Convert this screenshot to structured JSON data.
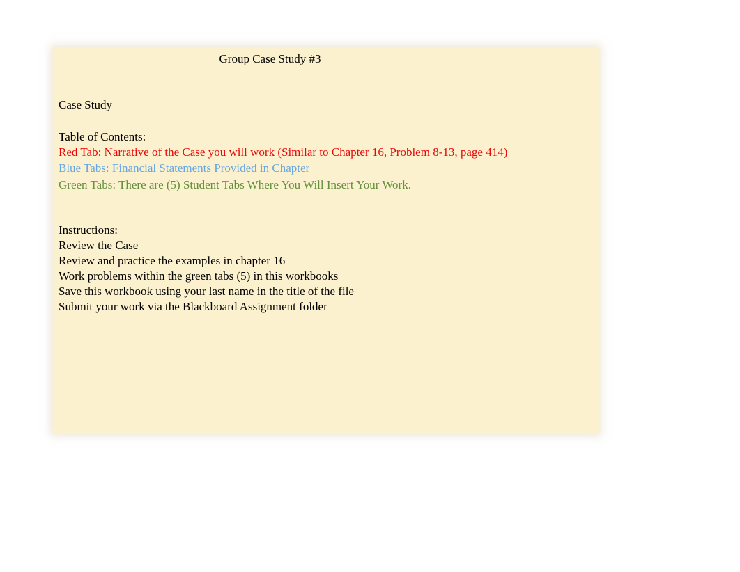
{
  "title": "Group Case Study #3",
  "case_study_heading": "Case Study",
  "toc": {
    "heading": "Table of Contents:",
    "red": "Red Tab: Narrative of the Case you will work (Similar to Chapter 16, Problem 8-13, page 414)",
    "blue": "Blue Tabs: Financial Statements Provided in Chapter",
    "green": "Green Tabs: There are (5) Student Tabs Where You Will Insert Your Work."
  },
  "instructions": {
    "heading": "Instructions:",
    "lines": [
      "Review the Case",
      "Review and practice the examples in chapter 16",
      "Work problems within the green tabs (5) in this workbooks",
      "Save this workbook using your last name in the title of the file",
      "Submit your work via the Blackboard Assignment folder"
    ]
  },
  "colors": {
    "background": "#fbf1ce",
    "red": "#ec0707",
    "blue": "#65a6e4",
    "green": "#62903c"
  }
}
